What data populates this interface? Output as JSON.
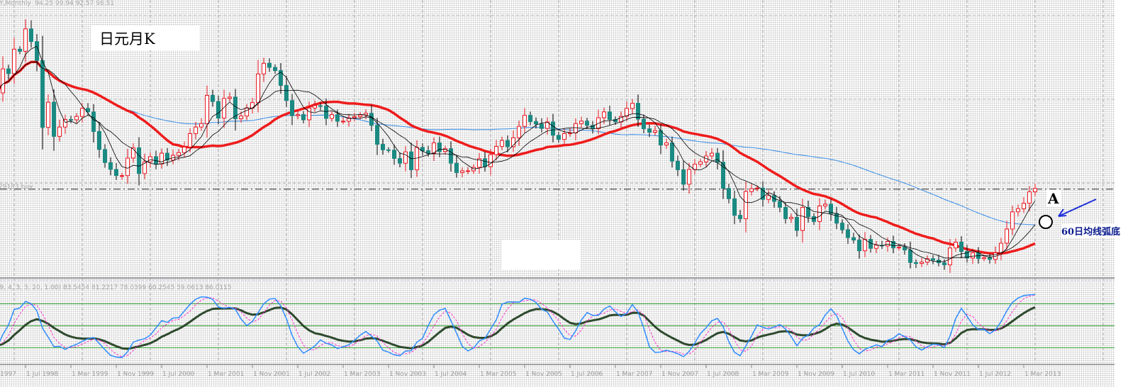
{
  "header": {
    "symbol_text": "PY,Monthly",
    "ohlc_text": "94.25 99.94 92.57 98.51"
  },
  "title_label": "日元月K",
  "order_line_label": "29183 buy",
  "indicator_label": "(9, 4, 3, 3, 20, 1.00) 83.5454 81.2217 78.0399 60.2545 59.0613 86.0115",
  "annotations": {
    "point_label": "A",
    "note": "60日均线弧底"
  },
  "colors": {
    "up": "#e8141e",
    "down": "#1a8a82",
    "ma_thick": "#ee1c1c",
    "ma_long": "#3a8ee6",
    "ma_short": "#000000",
    "stoch_fast": "#2f8cff",
    "stoch_signal": "#ff33cc",
    "stoch_slow": "#2e4a2e",
    "levels": "#2ea02e",
    "arrow": "#1f2fd8"
  },
  "chart_data": {
    "type": "candlestick",
    "symbol_timeframe": "Monthly",
    "start_month": "1998-01",
    "closes": [
      127.0,
      126.2,
      133.2,
      131.8,
      138.9,
      138.3,
      144.8,
      141.1,
      135.6,
      116.2,
      123.5,
      113.6,
      116.3,
      118.5,
      118.4,
      119.4,
      121.7,
      120.7,
      115.0,
      109.8,
      106.0,
      104.0,
      102.2,
      102.2,
      107.3,
      110.3,
      102.8,
      106.2,
      107.7,
      105.6,
      108.7,
      106.7,
      108.1,
      108.9,
      110.5,
      114.4,
      116.3,
      117.3,
      125.5,
      123.7,
      118.9,
      124.6,
      125.0,
      118.7,
      119.5,
      121.8,
      123.4,
      131.7,
      134.8,
      133.6,
      132.7,
      128.4,
      124.0,
      119.6,
      119.9,
      118.4,
      121.8,
      122.5,
      122.4,
      118.8,
      119.9,
      118.0,
      118.0,
      119.0,
      119.3,
      119.8,
      120.3,
      116.8,
      111.3,
      109.7,
      109.6,
      107.2,
      105.8,
      109.1,
      103.9,
      110.4,
      109.4,
      108.7,
      111.7,
      109.2,
      110.0,
      105.8,
      103.1,
      103.6,
      103.6,
      104.6,
      107.1,
      104.8,
      108.3,
      110.7,
      112.4,
      110.6,
      113.2,
      116.5,
      119.7,
      117.9,
      117.2,
      115.9,
      117.8,
      113.9,
      112.7,
      114.4,
      114.6,
      117.3,
      118.0,
      116.8,
      115.8,
      119.0,
      120.7,
      118.5,
      117.8,
      119.4,
      121.7,
      123.2,
      118.6,
      115.8,
      114.8,
      115.3,
      111.1,
      111.7,
      106.4,
      103.9,
      99.7,
      104.0,
      105.5,
      106.2,
      107.9,
      108.7,
      106.1,
      98.5,
      95.5,
      90.7,
      89.7,
      97.6,
      98.4,
      98.6,
      95.3,
      96.4,
      94.7,
      93.0,
      89.7,
      90.1,
      86.3,
      93.0,
      90.3,
      88.9,
      93.4,
      93.9,
      91.2,
      88.4,
      86.5,
      84.2,
      83.5,
      80.4,
      83.7,
      81.1,
      82.0,
      81.8,
      83.1,
      81.2,
      81.4,
      80.6,
      77.0,
      76.7,
      77.1,
      78.1,
      77.7,
      76.9,
      76.3,
      81.2,
      82.9,
      80.2,
      78.3,
      79.8,
      78.1,
      78.4,
      77.9,
      79.8,
      82.6,
      86.7,
      91.7,
      92.6,
      94.2,
      97.5,
      98.51
    ],
    "open_first": 130.5,
    "order_line_price": 98.29,
    "moving_averages": [
      {
        "period": 5,
        "style": "thin-black"
      },
      {
        "period": 10,
        "style": "thin-black"
      },
      {
        "period": 24,
        "style": "thick-red"
      },
      {
        "period": 60,
        "style": "thin-blue"
      }
    ],
    "indicator": {
      "type": "stochastic",
      "params": [
        9,
        4,
        3,
        3,
        20,
        1.0
      ],
      "levels": [
        80,
        50,
        20
      ],
      "ylim": [
        0,
        100
      ]
    },
    "x_tick_labels": [
      "1997",
      "1 Jul 1998",
      "1 Mar 1999",
      "1 Nov 1999",
      "1 Jul 2000",
      "1 Mar 2001",
      "1 Nov 2001",
      "1 Jul 2002",
      "1 Mar 2003",
      "1 Nov 2003",
      "1 Jul 2004",
      "1 Mar 2005",
      "1 Nov 2005",
      "1 Jul 2006",
      "1 Mar 2007",
      "1 Nov 2007",
      "1 Jul 2008",
      "1 Mar 2009",
      "1 Nov 2009",
      "1 Jul 2010",
      "1 Mar 2011",
      "1 Nov 2011",
      "1 Jul 2012",
      "1 Mar 2013"
    ],
    "ylim": [
      76,
      147
    ],
    "grid": true
  }
}
